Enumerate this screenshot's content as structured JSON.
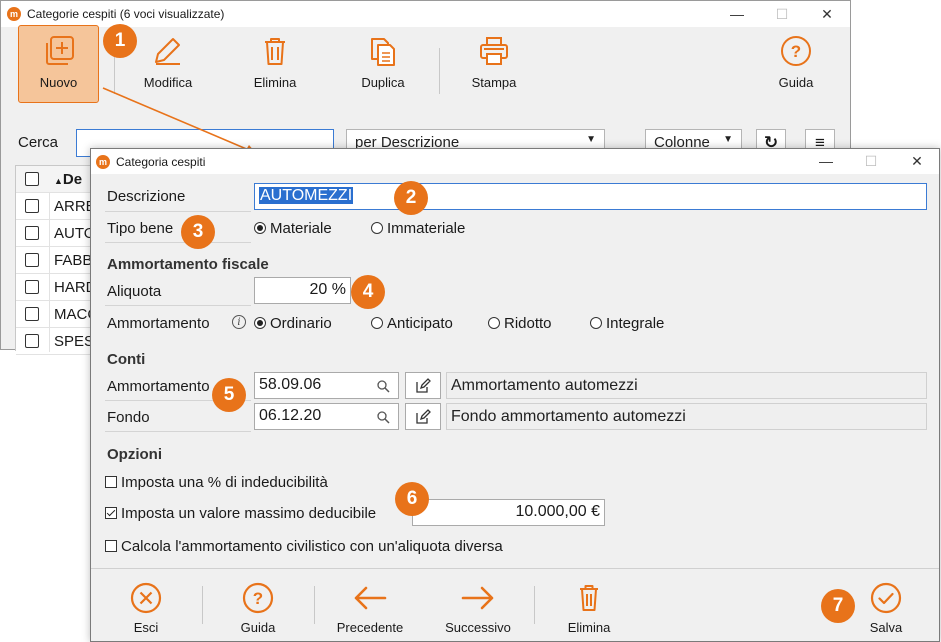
{
  "colors": {
    "accent": "#e8731a",
    "selection": "#2a6fcf"
  },
  "back_window": {
    "title": "Categorie cespiti (6 voci visualizzate)",
    "toolbar": [
      {
        "label": "Nuovo",
        "icon": "new-document-icon"
      },
      {
        "label": "Modifica",
        "icon": "edit-icon"
      },
      {
        "label": "Elimina",
        "icon": "trash-icon"
      },
      {
        "label": "Duplica",
        "icon": "duplicate-icon"
      },
      {
        "label": "Stampa",
        "icon": "printer-icon"
      },
      {
        "label": "Guida",
        "icon": "help-icon"
      }
    ],
    "search_label": "Cerca",
    "search_value": "",
    "search_mode": "per Descrizione",
    "columns_label": "Colonne",
    "grid_header": "De",
    "grid_rows": [
      "ARRE",
      "AUTO",
      "FABB",
      "HARD",
      "MACC",
      "SPES"
    ]
  },
  "badges": [
    "1",
    "2",
    "3",
    "4",
    "5",
    "6",
    "7"
  ],
  "dialog": {
    "title": "Categoria cespiti",
    "descrizione_label": "Descrizione",
    "descrizione_value": "AUTOMEZZI",
    "tipo_bene_label": "Tipo bene",
    "tipo_bene_options": [
      "Materiale",
      "Immateriale"
    ],
    "tipo_bene_selected": "Materiale",
    "ammortamento_fiscale_title": "Ammortamento fiscale",
    "aliquota_label": "Aliquota",
    "aliquota_value": "20 %",
    "ammortamento_label": "Ammortamento",
    "ammortamento_options": [
      "Ordinario",
      "Anticipato",
      "Ridotto",
      "Integrale"
    ],
    "ammortamento_selected": "Ordinario",
    "conti_title": "Conti",
    "conti": [
      {
        "label": "Ammortamento",
        "code": "58.09.06",
        "description": "Ammortamento automezzi"
      },
      {
        "label": "Fondo",
        "code": "06.12.20",
        "description": "Fondo ammortamento automezzi"
      }
    ],
    "opzioni_title": "Opzioni",
    "opzioni": [
      {
        "label": "Imposta una % di indeducibilità",
        "checked": false
      },
      {
        "label": "Imposta un valore massimo deducibile",
        "checked": true
      },
      {
        "label": "Calcola l'ammortamento civilistico con un'aliquota diversa",
        "checked": false
      }
    ],
    "valore_massimo": "10.000,00 €",
    "footer": [
      {
        "label": "Esci",
        "icon": "close-circle-icon"
      },
      {
        "label": "Guida",
        "icon": "help-icon"
      },
      {
        "label": "Precedente",
        "icon": "arrow-left-icon"
      },
      {
        "label": "Successivo",
        "icon": "arrow-right-icon"
      },
      {
        "label": "Elimina",
        "icon": "trash-icon"
      },
      {
        "label": "Salva",
        "icon": "check-circle-icon"
      }
    ]
  }
}
